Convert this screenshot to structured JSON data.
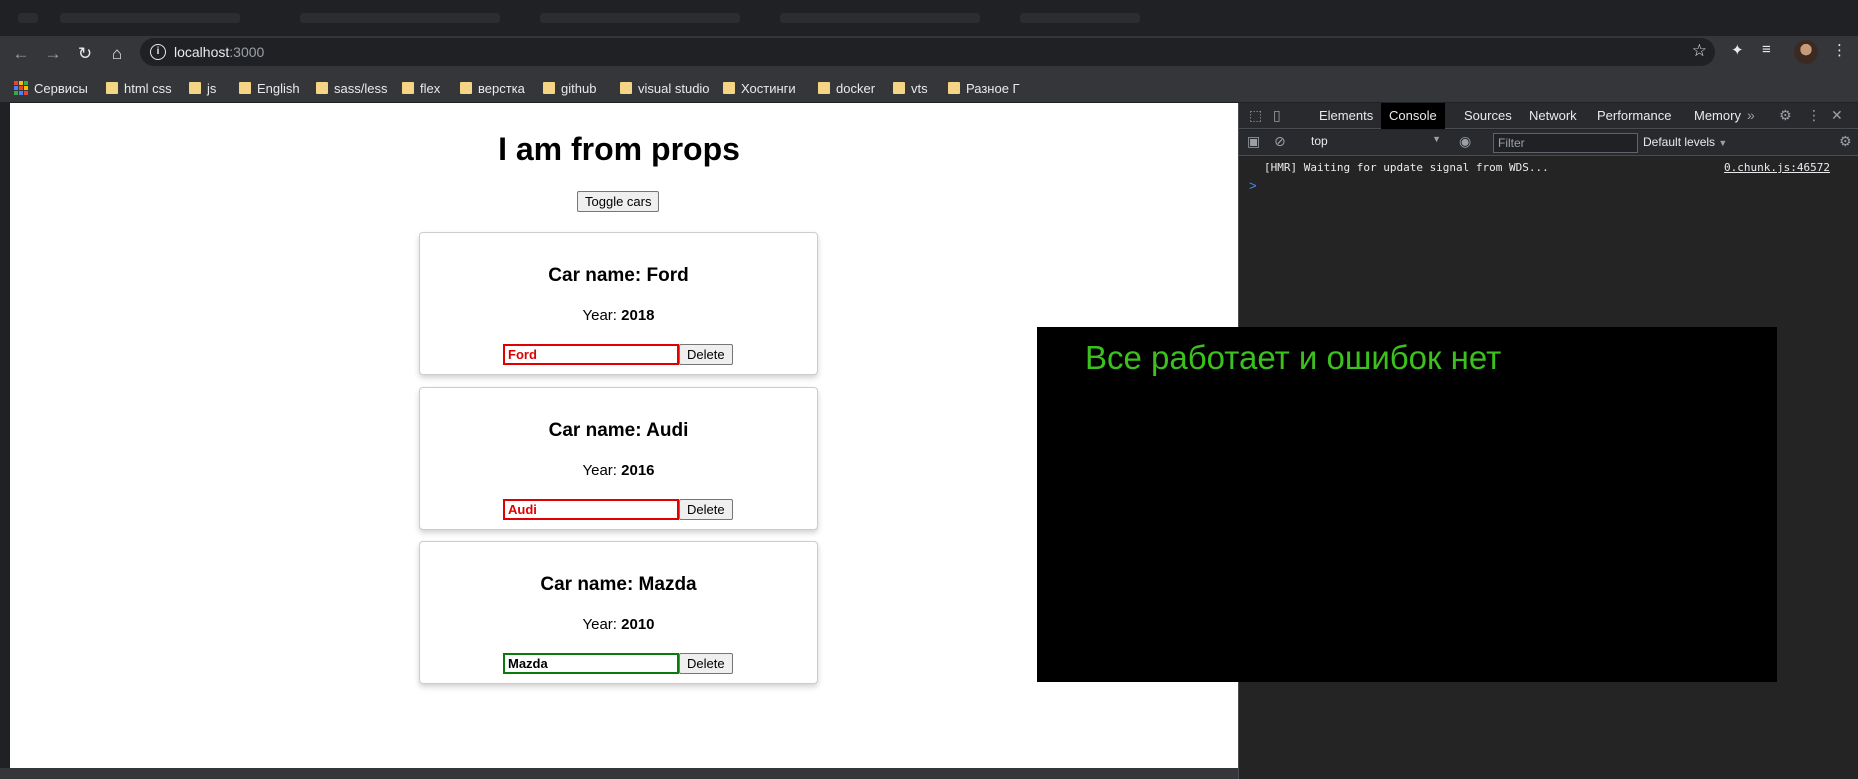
{
  "browser": {
    "url_host": "localhost",
    "url_port": ":3000",
    "bookmarks": [
      {
        "label": "Сервисы",
        "icon": "apps-icon"
      },
      {
        "label": "html css",
        "icon": "folder-icon"
      },
      {
        "label": "js",
        "icon": "folder-icon"
      },
      {
        "label": "English",
        "icon": "folder-icon"
      },
      {
        "label": "sass/less",
        "icon": "folder-icon"
      },
      {
        "label": "flex",
        "icon": "folder-icon"
      },
      {
        "label": "верстка",
        "icon": "folder-icon"
      },
      {
        "label": "github",
        "icon": "folder-icon"
      },
      {
        "label": "visual studio",
        "icon": "folder-icon"
      },
      {
        "label": "Хостинги",
        "icon": "folder-icon"
      },
      {
        "label": "docker",
        "icon": "folder-icon"
      },
      {
        "label": "vts",
        "icon": "folder-icon"
      },
      {
        "label": "Разное Г",
        "icon": "folder-icon"
      }
    ]
  },
  "app": {
    "title": "I am from props",
    "toggle_label": "Toggle cars",
    "cars": [
      {
        "name_label": "Car name: Ford",
        "year_prefix": "Year: ",
        "year": "2018",
        "input_value": "Ford",
        "input_state": "invalid",
        "delete_label": "Delete"
      },
      {
        "name_label": "Car name: Audi",
        "year_prefix": "Year: ",
        "year": "2016",
        "input_value": "Audi",
        "input_state": "invalid",
        "delete_label": "Delete"
      },
      {
        "name_label": "Car name: Mazda",
        "year_prefix": "Year: ",
        "year": "2010",
        "input_value": "Mazda",
        "input_state": "valid",
        "delete_label": "Delete"
      }
    ],
    "colors": {
      "invalid": "#e00000",
      "valid": "#0a7a0a"
    }
  },
  "devtools": {
    "tabs": [
      "Elements",
      "Console",
      "Sources",
      "Network",
      "Performance",
      "Memory"
    ],
    "active_tab": "Console",
    "context": "top",
    "filter_placeholder": "Filter",
    "levels": "Default levels",
    "messages": [
      {
        "text": "[HMR] Waiting for update signal from WDS...",
        "source": "0.chunk.js:46572"
      }
    ],
    "prompt": ">"
  },
  "overlay": {
    "text": "Все работает и ошибок нет",
    "color": "#3cc01e"
  }
}
